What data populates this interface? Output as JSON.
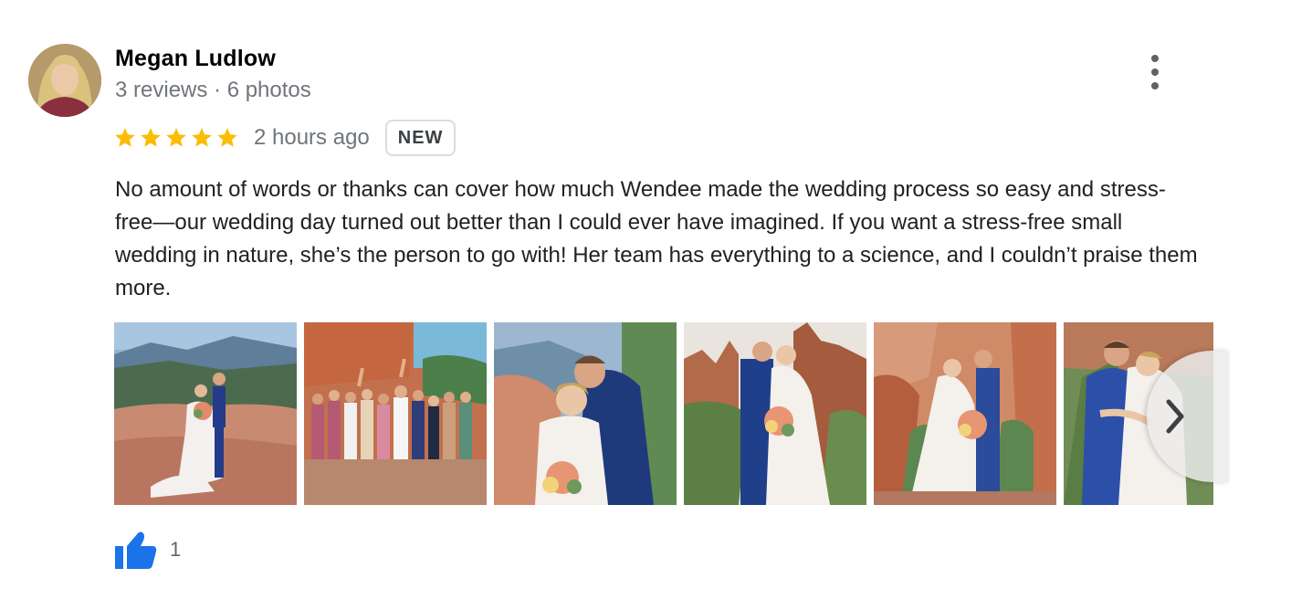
{
  "reviewer": {
    "name": "Megan Ludlow",
    "meta": "3 reviews · 6 photos",
    "avatar_icon": "profile-photo"
  },
  "rating": {
    "stars": 5,
    "star_color": "#fbbc04",
    "time": "2 hours ago",
    "badge": "NEW"
  },
  "review_text": "No amount of words or thanks can cover how much Wendee made the wedding process so easy and stress-free—our wedding day turned out better than I could ever have imagined. If you want a stress-free small wedding in nature, she’s the person to go with! Her team has everything to a science, and I couldn’t praise them more.",
  "photos": [
    {
      "name": "photo-couple-overlook"
    },
    {
      "name": "photo-wedding-party"
    },
    {
      "name": "photo-couple-closeup"
    },
    {
      "name": "photo-couple-kiss-rocks"
    },
    {
      "name": "photo-couple-kiss-canyon"
    },
    {
      "name": "photo-couple-embrace"
    }
  ],
  "likes": {
    "count": "1",
    "icon": "thumbs-up-icon",
    "color": "#1a73e8"
  },
  "controls": {
    "more_icon": "more-vert-icon",
    "next_icon": "chevron-right-icon"
  }
}
